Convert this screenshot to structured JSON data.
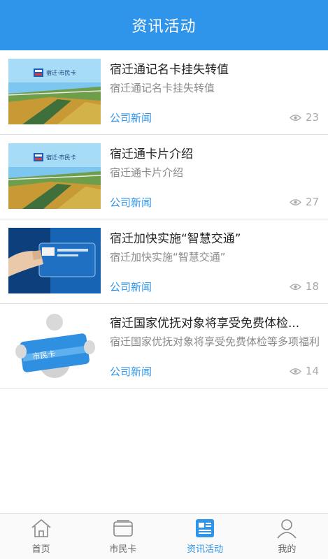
{
  "header": {
    "title": "资讯活动"
  },
  "news": [
    {
      "title": "宿迁通记名卡挂失转值",
      "desc": "宿迁通记名卡挂失转值",
      "category": "公司新闻",
      "views": "23"
    },
    {
      "title": "宿迁通卡片介绍",
      "desc": "宿迁通卡片介绍",
      "category": "公司新闻",
      "views": "27"
    },
    {
      "title": "宿迁加快实施“智慧交通”",
      "desc": "宿迁加快实施“智慧交通”",
      "category": "公司新闻",
      "views": "18"
    },
    {
      "title": "宿迁国家优抚对象将享受免费体检...",
      "desc": "宿迁国家优抚对象将享受免费体检等多项福利",
      "category": "公司新闻",
      "views": "14"
    }
  ],
  "thumb_text": {
    "brand": "宿迁·市民卡",
    "card2": "市民卡"
  },
  "tabs": [
    {
      "label": "首页",
      "icon": "home-icon",
      "active": false
    },
    {
      "label": "市民卡",
      "icon": "card-icon",
      "active": false
    },
    {
      "label": "资讯活动",
      "icon": "news-icon",
      "active": true
    },
    {
      "label": "我的",
      "icon": "user-icon",
      "active": false
    }
  ],
  "colors": {
    "primary": "#2f95ea",
    "text": "#222222",
    "muted": "#8a8a8a"
  }
}
